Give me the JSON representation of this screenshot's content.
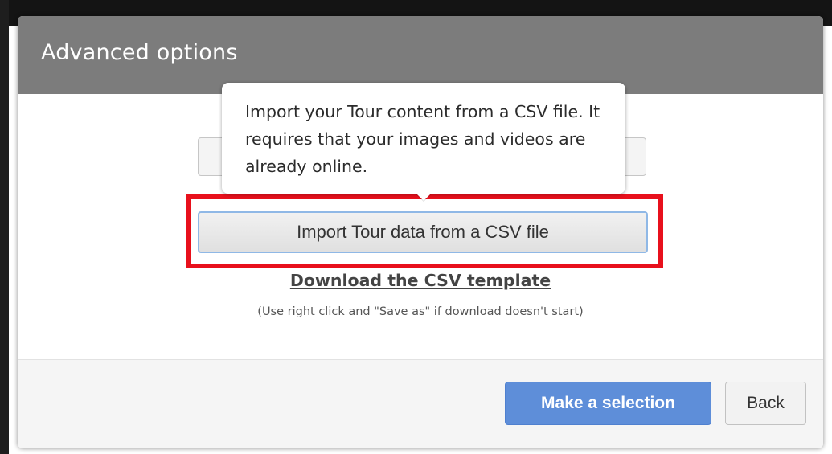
{
  "modal": {
    "title": "Advanced options"
  },
  "tooltip": {
    "text": "Import your Tour content from a CSV file. It requires that your images and videos are already online."
  },
  "body": {
    "import_button_label": "Import Tour data from a CSV file",
    "download_link_text": "Download the CSV template",
    "hint_text": "(Use right click and \"Save as\" if download doesn't start)"
  },
  "footer": {
    "primary_button_label": "Make a selection",
    "back_button_label": "Back"
  },
  "colors": {
    "header_bg": "#7c7c7c",
    "highlight_border": "#e8101c",
    "primary_button_bg": "#5e8ed9"
  }
}
